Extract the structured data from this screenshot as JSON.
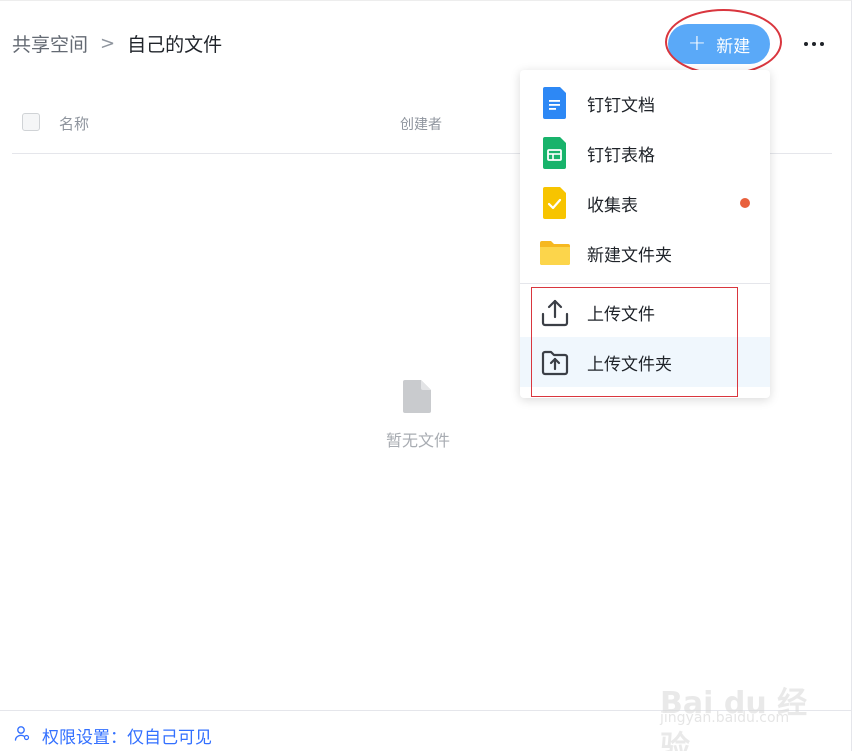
{
  "breadcrumb": {
    "root": "共享空间",
    "separator": ">",
    "current": "自己的文件"
  },
  "header": {
    "new_button_label": "新建",
    "more_icon": "ellipsis-icon"
  },
  "table": {
    "columns": [
      "名称",
      "创建者"
    ]
  },
  "empty_state": {
    "icon": "file-icon",
    "text": "暂无文件"
  },
  "new_menu": {
    "items": [
      {
        "label": "钉钉文档",
        "icon": "doc-icon",
        "color": "#2d88f5"
      },
      {
        "label": "钉钉表格",
        "icon": "sheet-icon",
        "color": "#18b36b"
      },
      {
        "label": "收集表",
        "icon": "form-icon",
        "color": "#f7c400",
        "has_dot": true
      },
      {
        "label": "新建文件夹",
        "icon": "folder-icon",
        "color": "#fcc934"
      },
      {
        "label": "上传文件",
        "icon": "upload-icon"
      },
      {
        "label": "上传文件夹",
        "icon": "upload-folder-icon"
      }
    ]
  },
  "footer": {
    "permission_text": "权限设置：仅自己可见",
    "icon": "user-lock-icon"
  },
  "watermark": {
    "text": "Bai du 经验",
    "sub": "jingyan.baidu.com"
  },
  "colors": {
    "accent": "#3370ff",
    "new_button": "#5aa9f8",
    "annotation_red": "#d9363e"
  }
}
